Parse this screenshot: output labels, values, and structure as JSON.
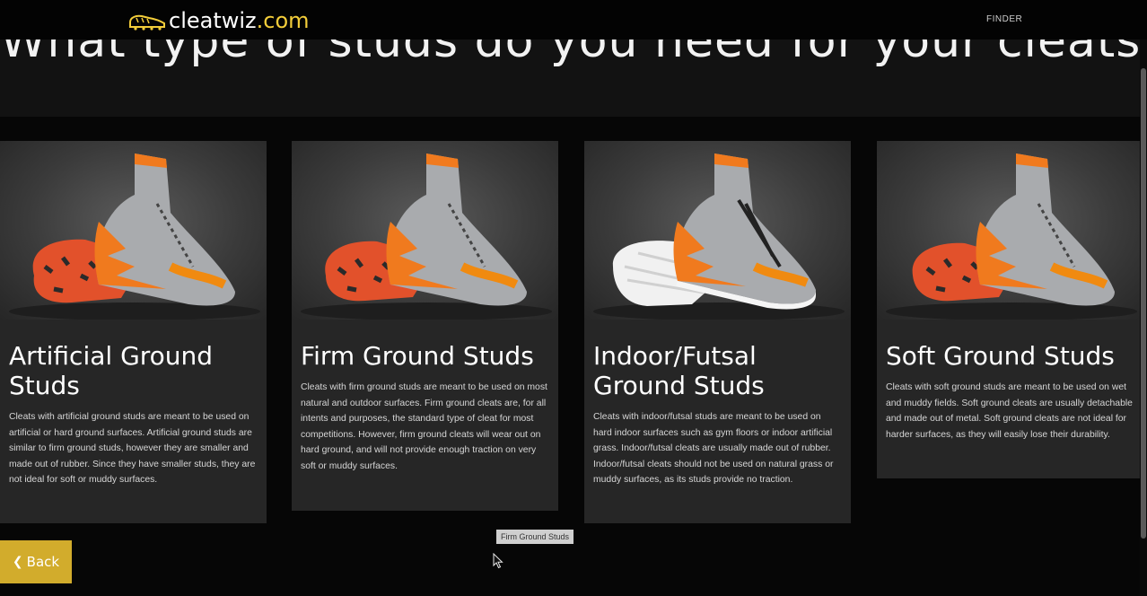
{
  "nav": {
    "logo_brand": "cleatwiz",
    "logo_tld": ".com",
    "finder_label": "FINDER"
  },
  "page": {
    "heading": "What type of studs do you need for your cleats?"
  },
  "cards": [
    {
      "title": "Artificial Ground Studs",
      "description": "Cleats with artificial ground studs are meant to be used on artificial or hard ground surfaces. Artificial ground studs are similar to firm ground studs, however they are smaller and made out of rubber. Since they have smaller studs, they are not ideal for soft or muddy surfaces."
    },
    {
      "title": "Firm Ground Studs",
      "description": "Cleats with firm ground studs are meant to be used on most natural and outdoor surfaces. Firm ground cleats are, for all intents and purposes, the standard type of cleat for most competitions. However, firm ground cleats will wear out on hard ground, and will not provide enough traction on very soft or muddy surfaces."
    },
    {
      "title": "Indoor/Futsal Ground Studs",
      "description": "Cleats with indoor/futsal studs are meant to be used on hard indoor surfaces such as gym floors or indoor artificial grass. Indoor/futsal cleats are usually made out of rubber. Indoor/futsal cleats should not be used on natural grass or muddy surfaces, as its studs provide no traction."
    },
    {
      "title": "Soft Ground Studs",
      "description": "Cleats with soft ground studs are meant to be used on wet and muddy fields. Soft ground cleats are usually detachable and made out of metal. Soft ground cleats are not ideal for harder surfaces, as they will easily lose their durability."
    }
  ],
  "back_button": {
    "label": "Back",
    "icon": "chevron-left-icon"
  },
  "tooltip": {
    "text": "Firm Ground Studs"
  },
  "colors": {
    "accent": "#d2ac2c",
    "logo_tld": "#f3cd3a",
    "cleat_orange": "#f07a1e",
    "card_bg": "#262626"
  }
}
